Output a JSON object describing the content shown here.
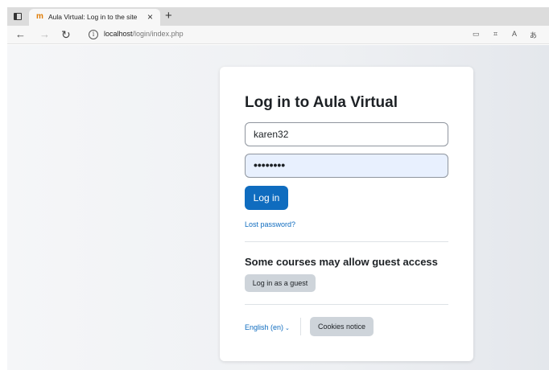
{
  "browser": {
    "tab_title": "Aula Virtual: Log in to the site",
    "tab_favicon": "moodle-logo-icon",
    "close_glyph": "×",
    "new_tab_glyph": "+",
    "url_host": "localhost",
    "url_path": "/login/index.php"
  },
  "login": {
    "heading": "Log in to Aula Virtual",
    "username_value": "karen32",
    "password_mask": "••••••••",
    "login_button": "Log in",
    "lost_password": "Lost password?",
    "guest_heading": "Some courses may allow guest access",
    "guest_button": "Log in as a guest",
    "language": "English (en)",
    "cookies_button": "Cookies notice"
  },
  "colors": {
    "primary": "#0f6cbf",
    "secondary_button": "#ced4da",
    "autofill_bg": "#e8f0fe"
  }
}
